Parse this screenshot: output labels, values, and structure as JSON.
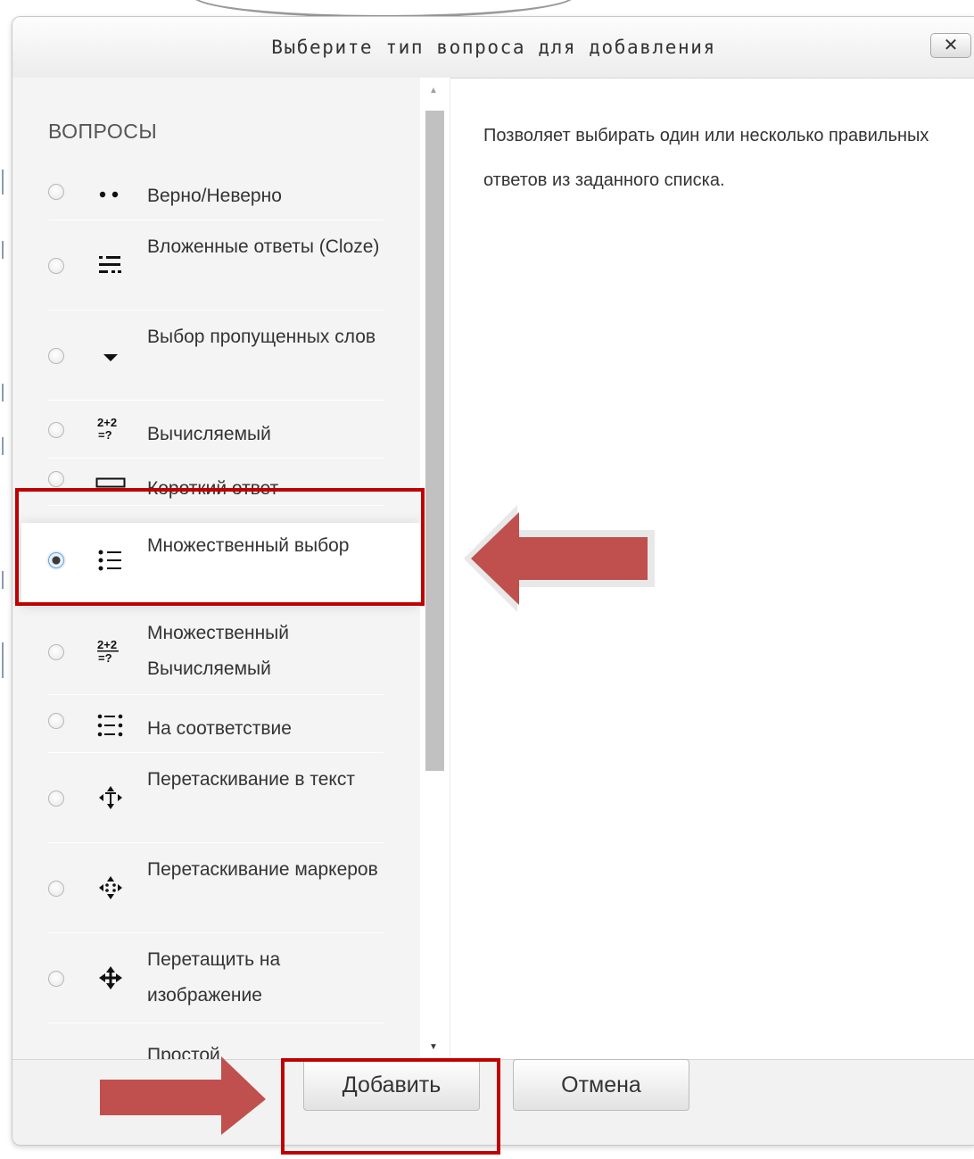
{
  "dialog": {
    "title": "Выберите тип вопроса для добавления",
    "close_label": "✕"
  },
  "questions": {
    "section_title": "ВОПРОСЫ",
    "items": [
      {
        "label": "Верно/Неверно",
        "icon": "truefalse-icon",
        "selected": false
      },
      {
        "label": "Вложенные ответы (Cloze)",
        "icon": "cloze-icon",
        "selected": false
      },
      {
        "label": "Выбор пропущенных слов",
        "icon": "dropdown-icon",
        "selected": false
      },
      {
        "label": "Вычисляемый",
        "icon": "calculated-icon",
        "selected": false
      },
      {
        "label": "Короткий ответ",
        "icon": "shortanswer-icon",
        "selected": false
      },
      {
        "label": "Множественный выбор",
        "icon": "multichoice-icon",
        "selected": true
      },
      {
        "label": "Множественный Вычисляемый",
        "icon": "calculated-multichoice-icon",
        "selected": false
      },
      {
        "label": "На соответствие",
        "icon": "match-icon",
        "selected": false
      },
      {
        "label": "Перетаскивание в текст",
        "icon": "drag-into-text-icon",
        "selected": false
      },
      {
        "label": "Перетаскивание маркеров",
        "icon": "drag-markers-icon",
        "selected": false
      },
      {
        "label": "Перетащить на изображение",
        "icon": "drag-onto-image-icon",
        "selected": false
      },
      {
        "label": "Простой",
        "icon": "simple-calculated-icon",
        "selected": false
      }
    ]
  },
  "description": "Позволяет выбирать один или несколько правильных ответов из заданного списка.",
  "footer": {
    "add_label": "Добавить",
    "cancel_label": "Отмена"
  },
  "annotation": {
    "highlight_color": "#c00000",
    "arrow_color": "#c0504d"
  }
}
